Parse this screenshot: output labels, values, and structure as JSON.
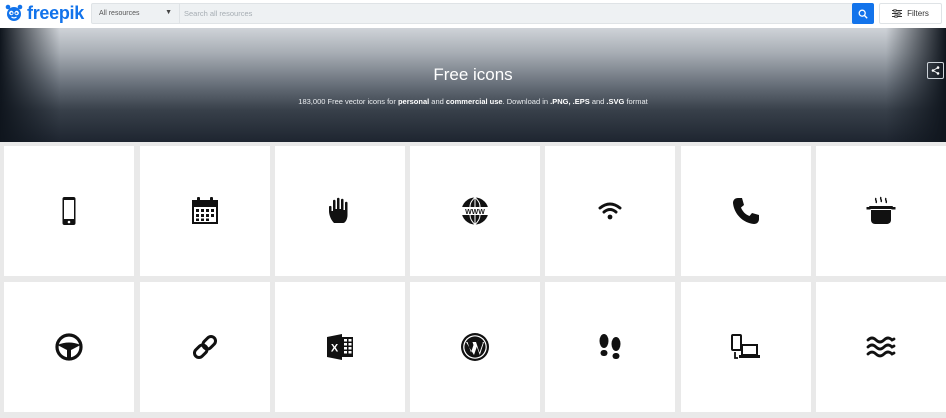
{
  "header": {
    "logo_text": "freepik",
    "category_label": "All resources",
    "search_placeholder": "Search all resources",
    "filters_label": "Filters"
  },
  "hero": {
    "title": "Free icons",
    "sub_part1": "183,000 Free vector icons for ",
    "sub_bold1": "personal",
    "sub_part2": " and ",
    "sub_bold2": "commercial use",
    "sub_part3": ". Download in ",
    "sub_bold3": ".PNG, .EPS",
    "sub_part4": " and ",
    "sub_bold4": ".SVG",
    "sub_part5": " format"
  },
  "colors": {
    "brand_blue": "#1273eb",
    "tile_bg": "#ffffff",
    "page_bg": "#e9e9e9"
  },
  "icons": [
    {
      "name": "smartphone-icon"
    },
    {
      "name": "calendar-icon"
    },
    {
      "name": "hand-icon"
    },
    {
      "name": "globe-www-icon"
    },
    {
      "name": "wifi-icon"
    },
    {
      "name": "phone-icon"
    },
    {
      "name": "cooking-pot-icon"
    },
    {
      "name": "steering-wheel-icon"
    },
    {
      "name": "link-icon"
    },
    {
      "name": "excel-icon"
    },
    {
      "name": "wordpress-icon"
    },
    {
      "name": "footprints-icon"
    },
    {
      "name": "devices-icon"
    },
    {
      "name": "waves-icon"
    }
  ]
}
